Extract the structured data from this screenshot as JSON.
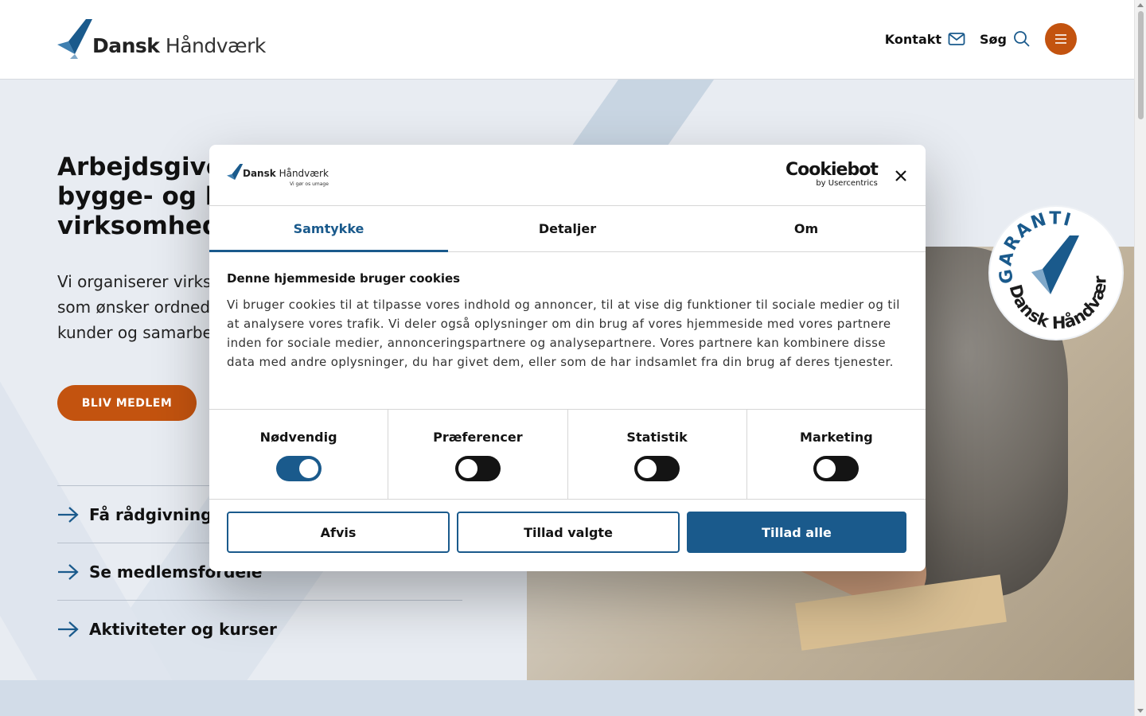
{
  "header": {
    "logo_word1": "Dansk",
    "logo_word2": "Håndværk",
    "nav": {
      "contact_label": "Kontakt",
      "search_label": "Søg"
    }
  },
  "hero": {
    "title_lines": [
      "Arbejdsgiver",
      "bygge- og h",
      "virksomhede"
    ],
    "text_lines": [
      "Vi organiserer virkso",
      "som ønsker ordnede",
      "kunder og samarbej"
    ],
    "cta_label": "BLIV MEDLEM",
    "links": [
      {
        "label": "Få rådgivning"
      },
      {
        "label": "Se medlemsfordele"
      },
      {
        "label": "Aktiviteter og kurser"
      }
    ],
    "badge_top": "GARANTI",
    "badge_bottom": "Dansk Håndværk"
  },
  "dialog": {
    "logo_word1": "Dansk",
    "logo_word2": "Håndværk",
    "logo_tagline": "Vi gør os umage",
    "cookiebot_main": "Cookiebot",
    "cookiebot_sub": "by Usercentrics",
    "tabs": [
      {
        "label": "Samtykke",
        "active": true
      },
      {
        "label": "Detaljer",
        "active": false
      },
      {
        "label": "Om",
        "active": false
      }
    ],
    "heading": "Denne hjemmeside bruger cookies",
    "body": "Vi bruger cookies til at tilpasse vores indhold og annoncer, til at vise dig funktioner til sociale medier og til at analysere vores trafik. Vi deler også oplysninger om din brug af vores hjemmeside med vores partnere inden for sociale medier, annonceringspartnere og analysepartnere. Vores partnere kan kombinere disse data med andre oplysninger, du har givet dem, eller som de har indsamlet fra din brug af deres tjenester.",
    "toggles": [
      {
        "label": "Nødvendig",
        "on": true
      },
      {
        "label": "Præferencer",
        "on": false
      },
      {
        "label": "Statistik",
        "on": false
      },
      {
        "label": "Marketing",
        "on": false
      }
    ],
    "buttons": {
      "reject": "Afvis",
      "allow_selected": "Tillad valgte",
      "allow_all": "Tillad alle"
    }
  },
  "colors": {
    "brand_blue": "#1a5a8c",
    "brand_orange": "#c3530f",
    "hero_bg": "#e8ecf2"
  }
}
